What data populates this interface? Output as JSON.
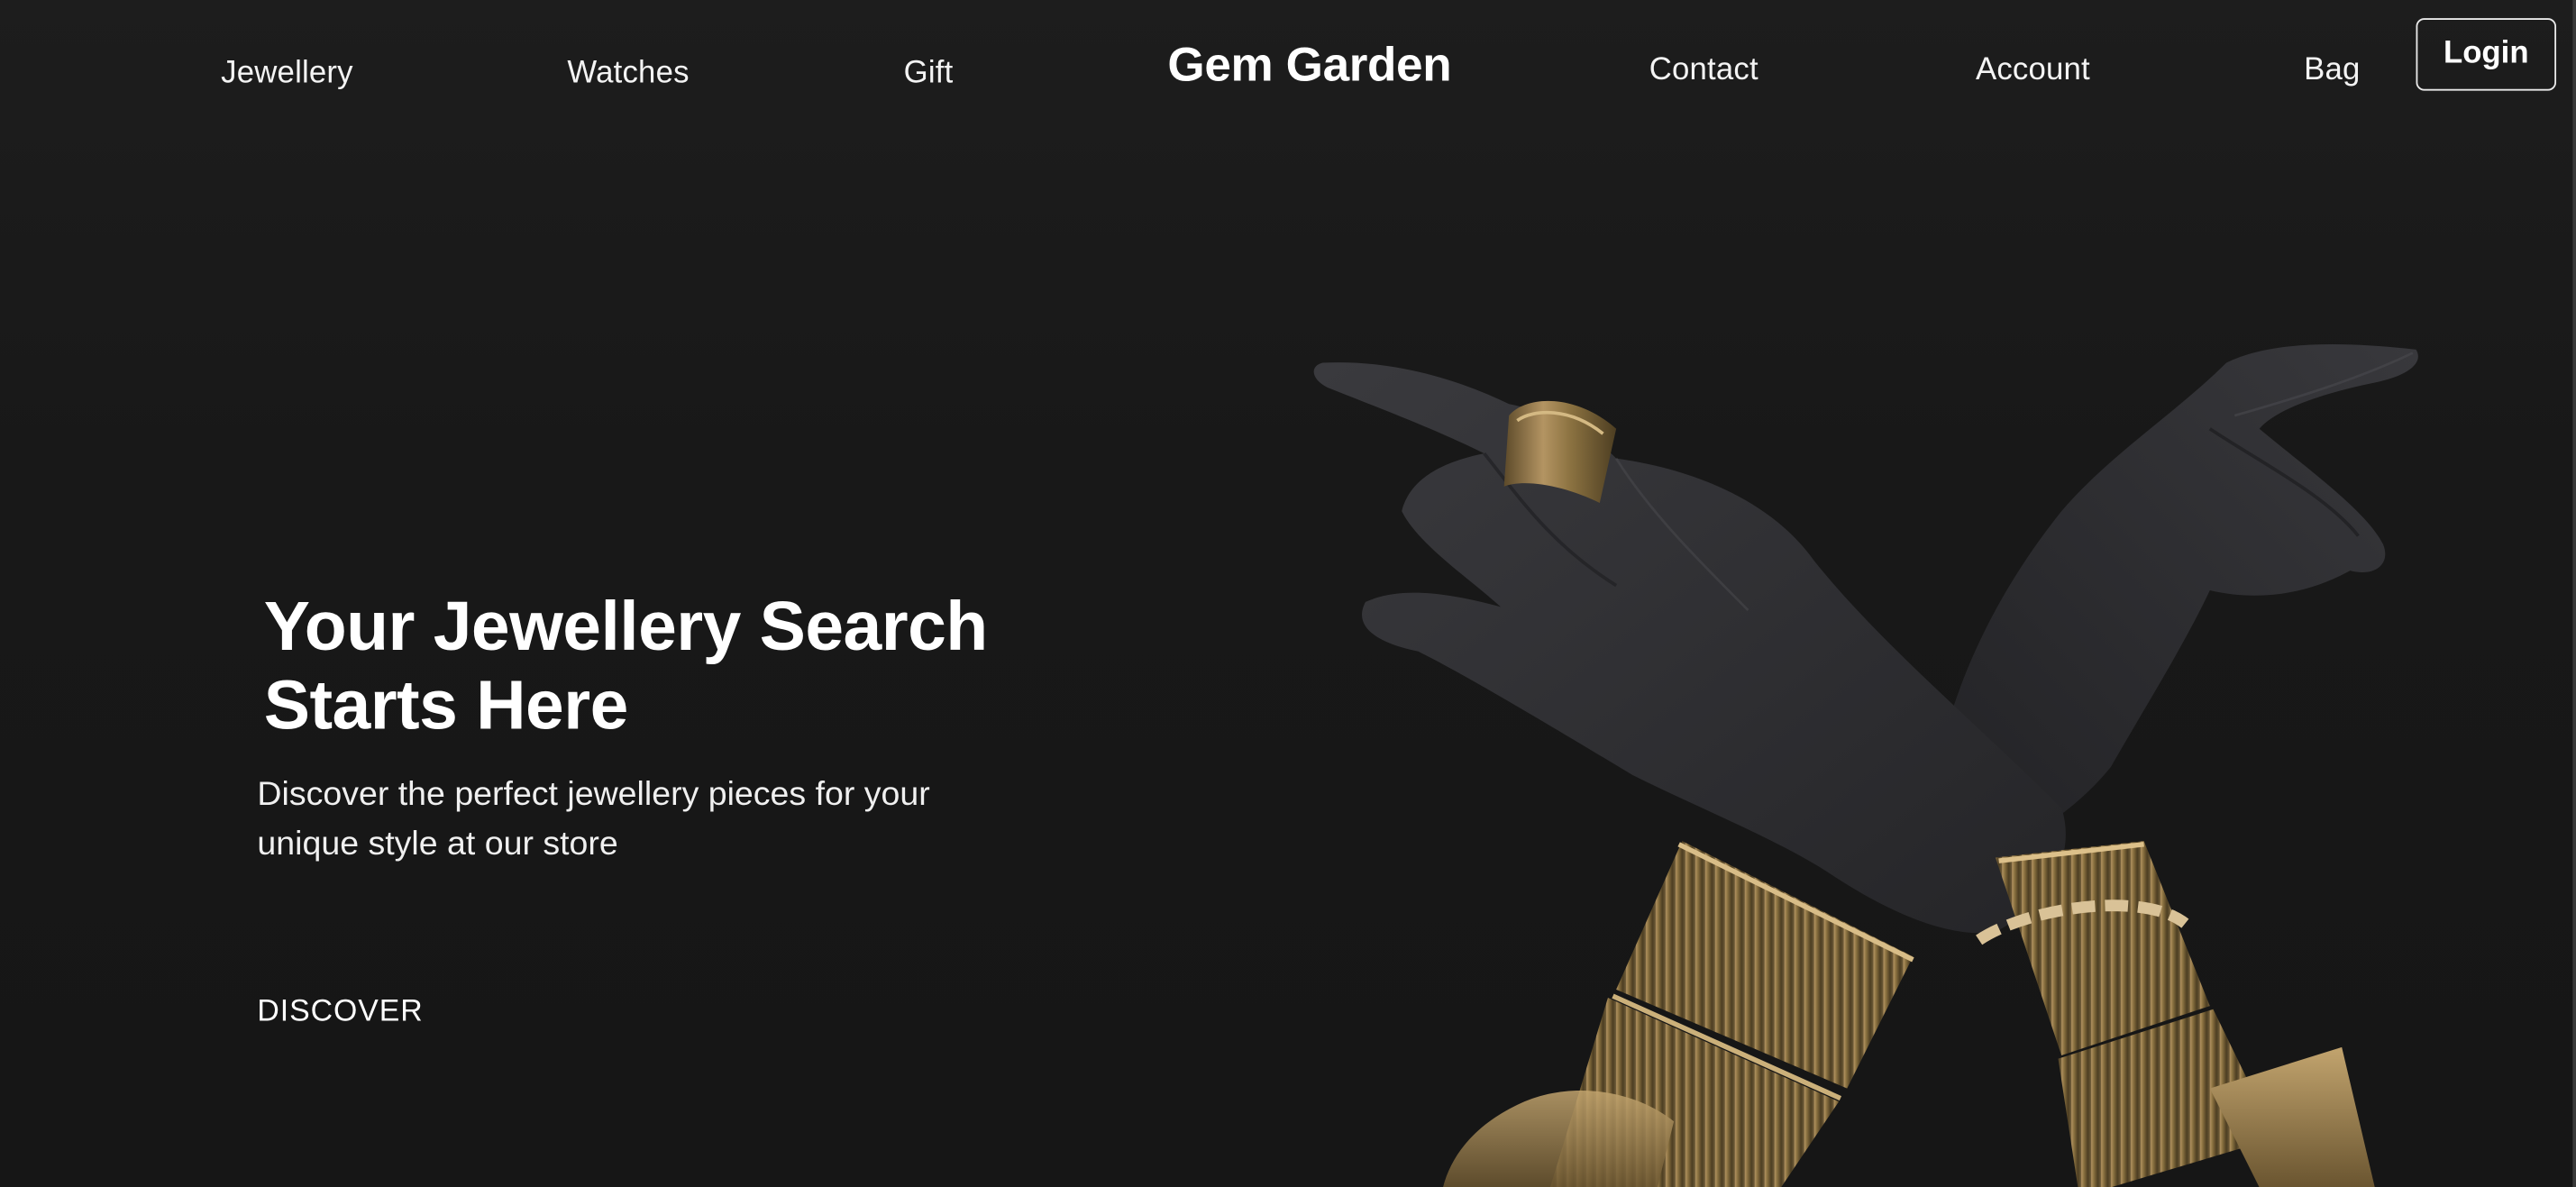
{
  "header": {
    "nav_left": [
      "Jewellery",
      "Watches",
      "Gift"
    ],
    "brand": "Gem Garden",
    "nav_right": [
      "Contact",
      "Account",
      "Bag"
    ],
    "login_label": "Login"
  },
  "hero": {
    "title": "Your Jewellery Search Starts Here",
    "subtitle": "Discover the perfect jewellery pieces for your unique style at our store",
    "cta_label": "DISCOVER",
    "image_alt": "Two dark hands crossed, wearing gold rings and bracelets"
  },
  "colors": {
    "background": "#181818",
    "text": "#ffffff",
    "gold": "#a8874f",
    "skin": "#2f2f33"
  }
}
